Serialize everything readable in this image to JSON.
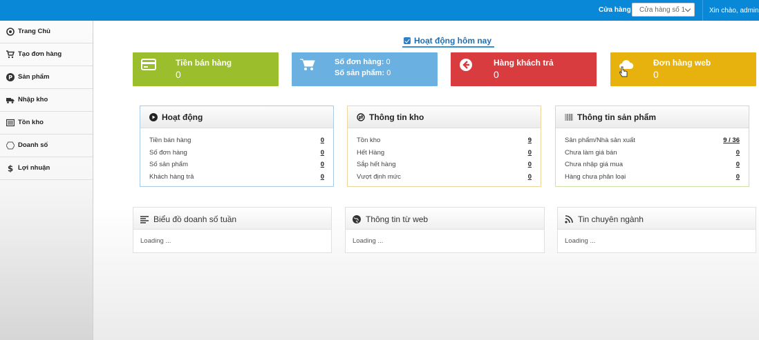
{
  "topbar": {
    "store_label": "Cửa hàng",
    "store_selected": "Cửa hàng số 1",
    "greeting": "Xin chào, admin"
  },
  "sidebar": {
    "items": [
      {
        "label": "Trang Chủ",
        "icon": "eye-icon"
      },
      {
        "label": "Tạo đơn hàng",
        "icon": "cart-icon"
      },
      {
        "label": "Sản phẩm",
        "icon": "product-p-icon"
      },
      {
        "label": "Nhập kho",
        "icon": "truck-icon"
      },
      {
        "label": "Tồn kho",
        "icon": "list-box-icon"
      },
      {
        "label": "Doanh số",
        "icon": "hexagon-icon"
      },
      {
        "label": "Lợi nhuận",
        "icon": "dollar-icon"
      }
    ]
  },
  "activity_title": "Hoạt động hôm nay",
  "stats": {
    "sales": {
      "title": "Tiền bán hàng",
      "value": "0",
      "color": "#9bbe2c"
    },
    "orders": {
      "line1_label": "Số đơn hàng:",
      "line1_value": "0",
      "line2_label": "Số sản phẩm:",
      "line2_value": "0",
      "color": "#6ab0e0"
    },
    "returns": {
      "title": "Hàng khách trả",
      "value": "0",
      "color": "#d93c3f"
    },
    "web": {
      "title": "Đơn hàng web",
      "value": "0",
      "color": "#e8b20e"
    }
  },
  "panels": {
    "activity": {
      "title": "Hoạt động",
      "border_color": "#a9cbe8",
      "rows": [
        {
          "label": "Tiền bán hàng",
          "value": "0"
        },
        {
          "label": "Số đơn hàng",
          "value": "0"
        },
        {
          "label": "Số sản phẩm",
          "value": "0"
        },
        {
          "label": "Khách hàng trả",
          "value": "0"
        }
      ]
    },
    "stock": {
      "title": "Thông tin kho",
      "border_color": "#ecd69a",
      "rows": [
        {
          "label": "Tồn kho",
          "value": "9"
        },
        {
          "label": "Hết Hàng",
          "value": "0"
        },
        {
          "label": "Sắp hết hàng",
          "value": "0"
        },
        {
          "label": "Vượt định mức",
          "value": "0"
        }
      ]
    },
    "product": {
      "title": "Thông tin sản phẩm",
      "border_color": "#cfe0a6",
      "rows": [
        {
          "label": "Sản phẩm/Nhà sản xuất",
          "value": "9 / 36"
        },
        {
          "label": "Chưa làm giá bán",
          "value": "0"
        },
        {
          "label": "Chưa nhập giá mua",
          "value": "0"
        },
        {
          "label": "Hàng chưa phân loại",
          "value": "0"
        }
      ]
    }
  },
  "bottom": {
    "weekly_sales": {
      "title": "Biểu đồ doanh số tuần",
      "loading": "Loading ..."
    },
    "web_info": {
      "title": "Thông tin từ web",
      "loading": "Loading ..."
    },
    "industry_news": {
      "title": "Tin chuyên ngành",
      "loading": "Loading ..."
    }
  }
}
